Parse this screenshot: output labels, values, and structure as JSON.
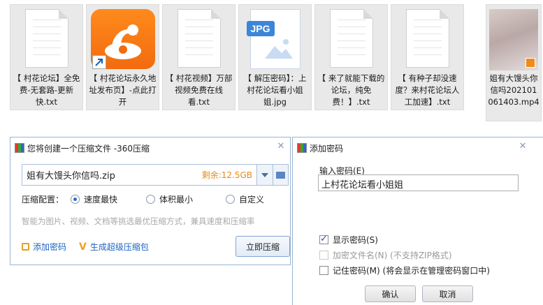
{
  "files": [
    {
      "type": "txt",
      "name": "【 村花论坛】全免费-无套路-更新快.txt"
    },
    {
      "type": "shortcut",
      "name": "【 村花论坛永久地址发布页】-点此打开"
    },
    {
      "type": "txt",
      "name": "【 村花视频】万部视频免费在线看.txt"
    },
    {
      "type": "jpg",
      "badge": "JPG",
      "name": "【 解压密码】：上村花论坛看小姐姐.jpg"
    },
    {
      "type": "txt",
      "name": "【 来了就能下载的论坛，纯免费！】.txt"
    },
    {
      "type": "txt",
      "name": "【 有种子却没速度？来村花论坛人工加速】.txt"
    },
    {
      "type": "mp4",
      "name": "姐有大馒头你信吗202101061403.mp4"
    }
  ],
  "compress_dialog": {
    "title": "您将创建一个压缩文件 -360压缩",
    "filename": "姐有大馒头你信吗.zip",
    "remaining": "剩余:12.5GB",
    "config_label": "压缩配置：",
    "options": [
      "速度最快",
      "体积最小",
      "自定义"
    ],
    "selected_option": 0,
    "hint": "智能为图片、视频、文档等挑选最优压缩方式，兼具速度和压缩率",
    "add_password": "添加密码",
    "super_package": "生成超级压缩包",
    "compress_button": "立即压缩"
  },
  "password_dialog": {
    "title": "添加密码",
    "input_label": "输入密码(E)",
    "password_value": "上村花论坛看小姐姐",
    "show_password": {
      "label": "显示密码(S)",
      "checked": true,
      "enabled": true
    },
    "encrypt_names": {
      "label": "加密文件名(N) (不支持ZIP格式)",
      "checked": false,
      "enabled": false
    },
    "remember": {
      "label": "记住密码(M) (将会显示在管理密码窗口中)",
      "checked": false,
      "enabled": true
    },
    "ok": "确认",
    "cancel": "取消"
  }
}
